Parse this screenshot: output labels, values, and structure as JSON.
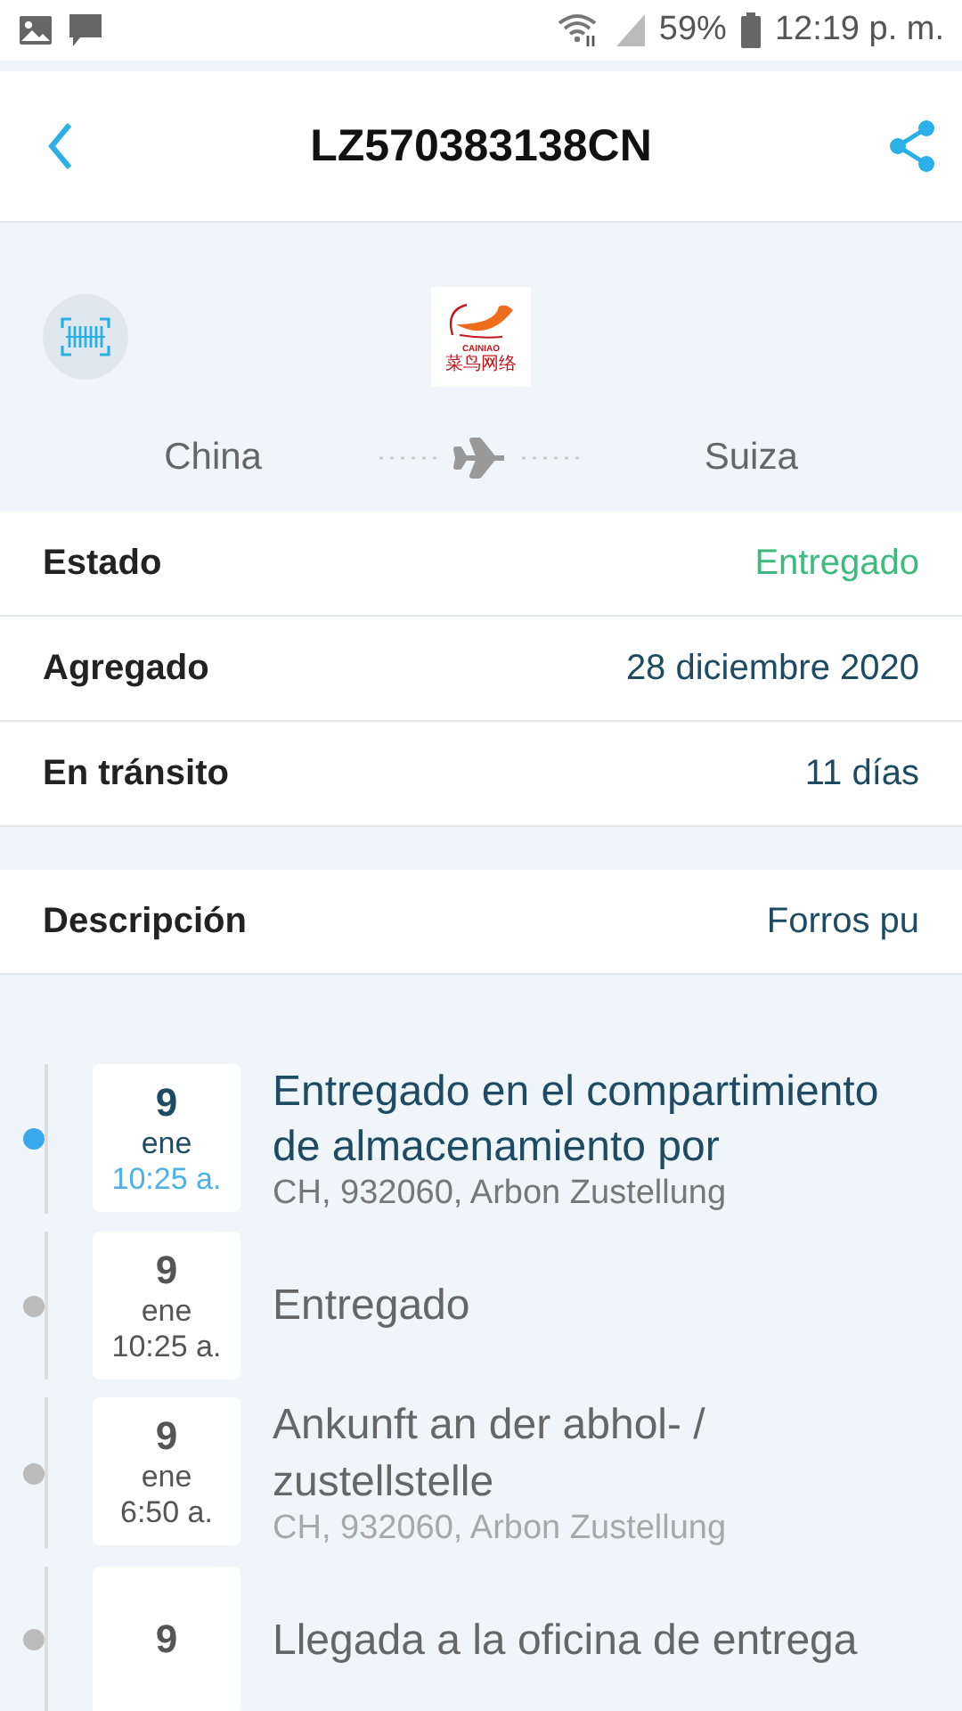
{
  "status_bar": {
    "battery": "59%",
    "time": "12:19 p. m."
  },
  "header": {
    "title": "LZ570383138CN"
  },
  "carrier": {
    "logo_text": "CAINIAO",
    "logo_text_cjk": "菜鸟网络"
  },
  "route": {
    "origin": "China",
    "destination": "Suiza"
  },
  "details": [
    {
      "label": "Estado",
      "value": "Entregado",
      "kind": "status"
    },
    {
      "label": "Agregado",
      "value": "28 diciembre 2020",
      "kind": "plain"
    },
    {
      "label": "En tránsito",
      "value": "11 días",
      "kind": "plain"
    }
  ],
  "description": {
    "label": "Descripción",
    "value": "Forros pu"
  },
  "events": [
    {
      "day": "9",
      "month": "ene",
      "time": "10:25 a.",
      "title": "Entregado en el compartimiento de almacenamiento por",
      "location": "CH, 932060, Arbon Zustellung",
      "selected": true,
      "faded_location": false
    },
    {
      "day": "9",
      "month": "ene",
      "time": "10:25 a.",
      "title": "Entregado",
      "selected": false
    },
    {
      "day": "9",
      "month": "ene",
      "time": "6:50 a.",
      "title": "Ankunft an der abhol- / zustellstelle",
      "location": "CH, 932060, Arbon Zustellung",
      "selected": false,
      "faded_location": true
    },
    {
      "day": "9",
      "title": "Llegada a la oficina de entrega",
      "selected": false
    }
  ]
}
